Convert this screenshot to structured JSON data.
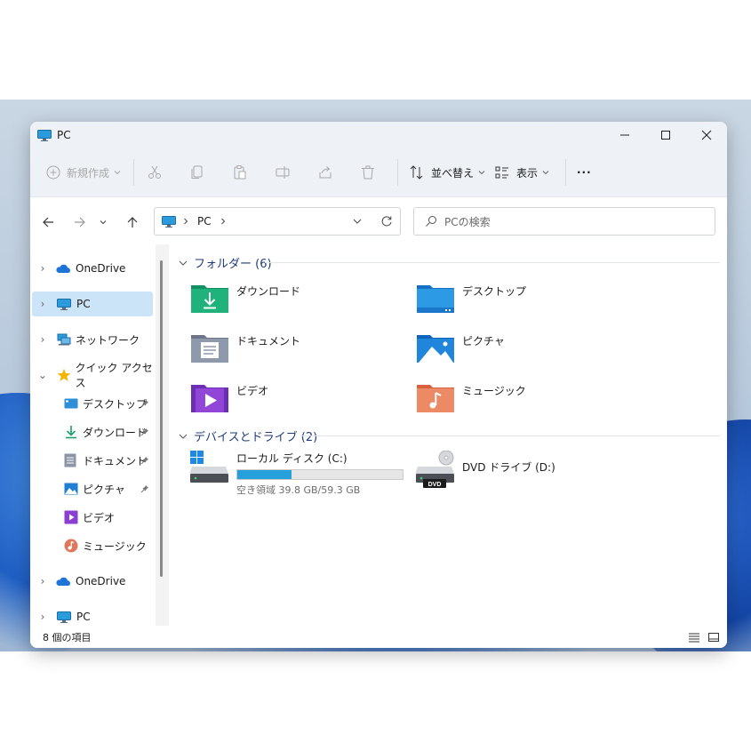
{
  "window": {
    "title": "PC"
  },
  "ribbon": {
    "new_label": "新規作成",
    "sort_label": "並べ替え",
    "view_label": "表示",
    "more_label": "···"
  },
  "address": {
    "root": "PC",
    "search_placeholder": "PCの検索"
  },
  "sidebar": {
    "items": [
      {
        "label": "OneDrive",
        "icon": "onedrive-icon"
      },
      {
        "label": "PC",
        "icon": "pc-icon",
        "selected": true
      },
      {
        "label": "ネットワーク",
        "icon": "network-icon"
      },
      {
        "label": "クイック アクセス",
        "icon": "star-icon",
        "expanded": true
      },
      {
        "label": "デスクトップ",
        "icon": "desktop-icon",
        "pinned": true
      },
      {
        "label": "ダウンロード",
        "icon": "download-icon",
        "pinned": true
      },
      {
        "label": "ドキュメント",
        "icon": "document-icon",
        "pinned": true
      },
      {
        "label": "ピクチャ",
        "icon": "pictures-icon",
        "pinned": true
      },
      {
        "label": "ビデオ",
        "icon": "video-icon"
      },
      {
        "label": "ミュージック",
        "icon": "music-icon"
      },
      {
        "label": "OneDrive",
        "icon": "onedrive-icon"
      },
      {
        "label": "PC",
        "icon": "pc-icon"
      }
    ]
  },
  "content": {
    "folders_header": "フォルダー (6)",
    "drives_header": "デバイスとドライブ (2)",
    "folders": [
      {
        "label": "ダウンロード",
        "icon": "download-folder-icon"
      },
      {
        "label": "デスクトップ",
        "icon": "desktop-folder-icon"
      },
      {
        "label": "ドキュメント",
        "icon": "documents-folder-icon"
      },
      {
        "label": "ピクチャ",
        "icon": "pictures-folder-icon"
      },
      {
        "label": "ビデオ",
        "icon": "videos-folder-icon"
      },
      {
        "label": "ミュージック",
        "icon": "music-folder-icon"
      }
    ],
    "drives": [
      {
        "label": "ローカル ディスク (C:)",
        "space": "空き領域 39.8 GB/59.3 GB",
        "used_fraction": 0.33,
        "icon": "windows-drive-icon"
      },
      {
        "label": "DVD ドライブ (D:)",
        "icon": "dvd-drive-icon",
        "badge": "DVD"
      }
    ]
  },
  "status": {
    "count_text": "8 個の項目"
  },
  "colors": {
    "accent": "#26a0da",
    "selection": "#cce4f7",
    "header_text": "#1f3d7a"
  }
}
